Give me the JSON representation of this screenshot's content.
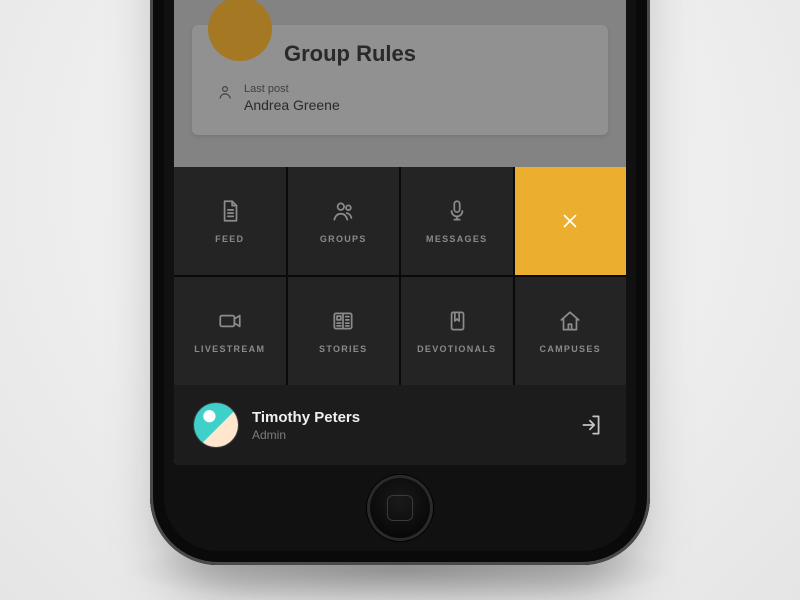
{
  "backdrop": {
    "card_title": "Group Rules",
    "last_post_label": "Last post",
    "last_post_author": "Andrea Greene"
  },
  "menu": {
    "tiles": [
      {
        "label": "FEED",
        "icon": "document-icon"
      },
      {
        "label": "GROUPS",
        "icon": "people-icon"
      },
      {
        "label": "MESSAGES",
        "icon": "microphone-icon"
      },
      {
        "label": "",
        "icon": "close-icon"
      },
      {
        "label": "LIVESTREAM",
        "icon": "video-icon"
      },
      {
        "label": "STORIES",
        "icon": "newspaper-icon"
      },
      {
        "label": "DEVOTIONALS",
        "icon": "bookmark-icon"
      },
      {
        "label": "CAMPUSES",
        "icon": "home-icon"
      }
    ]
  },
  "account": {
    "name": "Timothy Peters",
    "role": "Admin"
  },
  "colors": {
    "accent": "#ecae2f",
    "panel": "#141414"
  }
}
